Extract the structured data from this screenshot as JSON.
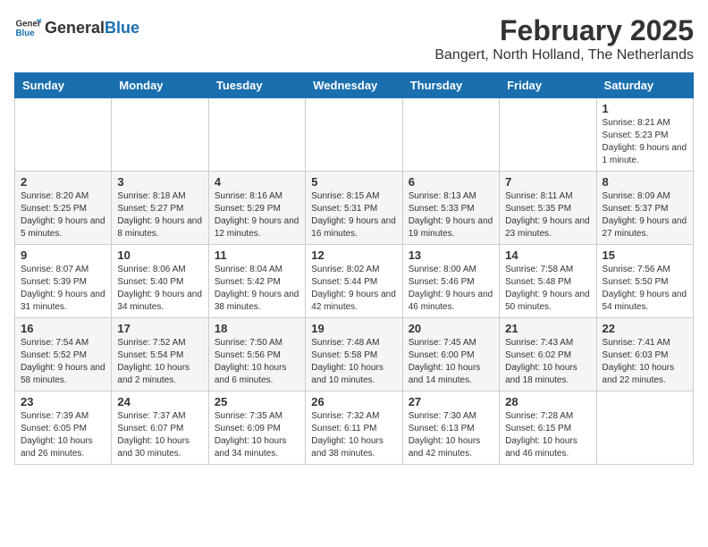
{
  "logo": {
    "general": "General",
    "blue": "Blue"
  },
  "title": "February 2025",
  "subtitle": "Bangert, North Holland, The Netherlands",
  "days_header": [
    "Sunday",
    "Monday",
    "Tuesday",
    "Wednesday",
    "Thursday",
    "Friday",
    "Saturday"
  ],
  "weeks": [
    [
      {
        "day": "",
        "info": ""
      },
      {
        "day": "",
        "info": ""
      },
      {
        "day": "",
        "info": ""
      },
      {
        "day": "",
        "info": ""
      },
      {
        "day": "",
        "info": ""
      },
      {
        "day": "",
        "info": ""
      },
      {
        "day": "1",
        "info": "Sunrise: 8:21 AM\nSunset: 5:23 PM\nDaylight: 9 hours and 1 minute."
      }
    ],
    [
      {
        "day": "2",
        "info": "Sunrise: 8:20 AM\nSunset: 5:25 PM\nDaylight: 9 hours and 5 minutes."
      },
      {
        "day": "3",
        "info": "Sunrise: 8:18 AM\nSunset: 5:27 PM\nDaylight: 9 hours and 8 minutes."
      },
      {
        "day": "4",
        "info": "Sunrise: 8:16 AM\nSunset: 5:29 PM\nDaylight: 9 hours and 12 minutes."
      },
      {
        "day": "5",
        "info": "Sunrise: 8:15 AM\nSunset: 5:31 PM\nDaylight: 9 hours and 16 minutes."
      },
      {
        "day": "6",
        "info": "Sunrise: 8:13 AM\nSunset: 5:33 PM\nDaylight: 9 hours and 19 minutes."
      },
      {
        "day": "7",
        "info": "Sunrise: 8:11 AM\nSunset: 5:35 PM\nDaylight: 9 hours and 23 minutes."
      },
      {
        "day": "8",
        "info": "Sunrise: 8:09 AM\nSunset: 5:37 PM\nDaylight: 9 hours and 27 minutes."
      }
    ],
    [
      {
        "day": "9",
        "info": "Sunrise: 8:07 AM\nSunset: 5:39 PM\nDaylight: 9 hours and 31 minutes."
      },
      {
        "day": "10",
        "info": "Sunrise: 8:06 AM\nSunset: 5:40 PM\nDaylight: 9 hours and 34 minutes."
      },
      {
        "day": "11",
        "info": "Sunrise: 8:04 AM\nSunset: 5:42 PM\nDaylight: 9 hours and 38 minutes."
      },
      {
        "day": "12",
        "info": "Sunrise: 8:02 AM\nSunset: 5:44 PM\nDaylight: 9 hours and 42 minutes."
      },
      {
        "day": "13",
        "info": "Sunrise: 8:00 AM\nSunset: 5:46 PM\nDaylight: 9 hours and 46 minutes."
      },
      {
        "day": "14",
        "info": "Sunrise: 7:58 AM\nSunset: 5:48 PM\nDaylight: 9 hours and 50 minutes."
      },
      {
        "day": "15",
        "info": "Sunrise: 7:56 AM\nSunset: 5:50 PM\nDaylight: 9 hours and 54 minutes."
      }
    ],
    [
      {
        "day": "16",
        "info": "Sunrise: 7:54 AM\nSunset: 5:52 PM\nDaylight: 9 hours and 58 minutes."
      },
      {
        "day": "17",
        "info": "Sunrise: 7:52 AM\nSunset: 5:54 PM\nDaylight: 10 hours and 2 minutes."
      },
      {
        "day": "18",
        "info": "Sunrise: 7:50 AM\nSunset: 5:56 PM\nDaylight: 10 hours and 6 minutes."
      },
      {
        "day": "19",
        "info": "Sunrise: 7:48 AM\nSunset: 5:58 PM\nDaylight: 10 hours and 10 minutes."
      },
      {
        "day": "20",
        "info": "Sunrise: 7:45 AM\nSunset: 6:00 PM\nDaylight: 10 hours and 14 minutes."
      },
      {
        "day": "21",
        "info": "Sunrise: 7:43 AM\nSunset: 6:02 PM\nDaylight: 10 hours and 18 minutes."
      },
      {
        "day": "22",
        "info": "Sunrise: 7:41 AM\nSunset: 6:03 PM\nDaylight: 10 hours and 22 minutes."
      }
    ],
    [
      {
        "day": "23",
        "info": "Sunrise: 7:39 AM\nSunset: 6:05 PM\nDaylight: 10 hours and 26 minutes."
      },
      {
        "day": "24",
        "info": "Sunrise: 7:37 AM\nSunset: 6:07 PM\nDaylight: 10 hours and 30 minutes."
      },
      {
        "day": "25",
        "info": "Sunrise: 7:35 AM\nSunset: 6:09 PM\nDaylight: 10 hours and 34 minutes."
      },
      {
        "day": "26",
        "info": "Sunrise: 7:32 AM\nSunset: 6:11 PM\nDaylight: 10 hours and 38 minutes."
      },
      {
        "day": "27",
        "info": "Sunrise: 7:30 AM\nSunset: 6:13 PM\nDaylight: 10 hours and 42 minutes."
      },
      {
        "day": "28",
        "info": "Sunrise: 7:28 AM\nSunset: 6:15 PM\nDaylight: 10 hours and 46 minutes."
      },
      {
        "day": "",
        "info": ""
      }
    ]
  ]
}
